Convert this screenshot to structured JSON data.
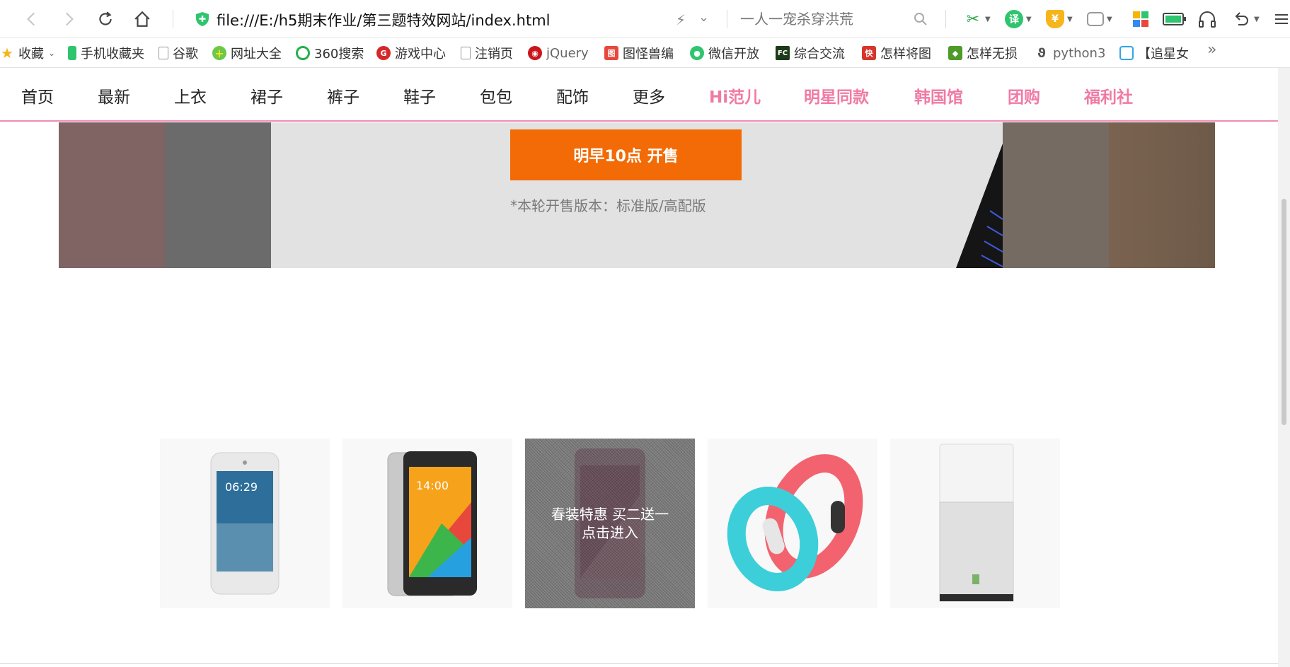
{
  "browser": {
    "url": "file:///E:/h5期末作业/第三题特效网站/index.html",
    "search_placeholder": "一人一宠杀穿洪荒"
  },
  "bookmarks": [
    {
      "label": "收藏",
      "icon": "star-icon"
    },
    {
      "label": "手机收藏夹",
      "icon": "phone-icon"
    },
    {
      "label": "谷歌",
      "icon": "page-icon"
    },
    {
      "label": "网址大全",
      "icon": "plus-circle-icon"
    },
    {
      "label": "360搜索",
      "icon": "search-360-icon"
    },
    {
      "label": "游戏中心",
      "icon": "game-icon"
    },
    {
      "label": "注销页",
      "icon": "page-icon"
    },
    {
      "label": "jQuery",
      "icon": "jquery-icon"
    },
    {
      "label": "图怪兽编",
      "icon": "image-icon"
    },
    {
      "label": "微信开放",
      "icon": "wechat-icon"
    },
    {
      "label": "综合交流",
      "icon": "fc-icon"
    },
    {
      "label": "怎样将图",
      "icon": "kuai-icon"
    },
    {
      "label": "怎样无损",
      "icon": "tag-icon"
    },
    {
      "label": "python3",
      "icon": "python-icon"
    },
    {
      "label": "【追星女",
      "icon": "bilibili-icon"
    }
  ],
  "nav": {
    "items": [
      {
        "label": "首页",
        "highlight": false
      },
      {
        "label": "最新",
        "highlight": false
      },
      {
        "label": "上衣",
        "highlight": false
      },
      {
        "label": "裙子",
        "highlight": false
      },
      {
        "label": "裤子",
        "highlight": false
      },
      {
        "label": "鞋子",
        "highlight": false
      },
      {
        "label": "包包",
        "highlight": false
      },
      {
        "label": "配饰",
        "highlight": false
      },
      {
        "label": "更多",
        "highlight": false
      },
      {
        "label": "Hi范儿",
        "highlight": true
      },
      {
        "label": "明星同款",
        "highlight": true
      },
      {
        "label": "韩国馆",
        "highlight": true
      },
      {
        "label": "团购",
        "highlight": true
      },
      {
        "label": "福利社",
        "highlight": true
      }
    ],
    "highlight_color": "#f07aa4"
  },
  "banner": {
    "cta": "明早10点 开售",
    "note": "*本轮开售版本：标准版/高配版",
    "cta_color": "#f26b06"
  },
  "products": [
    {
      "name": "phone-white-icon"
    },
    {
      "name": "phone-rainbow-icon"
    },
    {
      "name": "phone-pink-icon",
      "overlay_line1": "春装特惠 买二送一",
      "overlay_line2": "点击进入"
    },
    {
      "name": "band-icon"
    },
    {
      "name": "purifier-icon"
    }
  ]
}
